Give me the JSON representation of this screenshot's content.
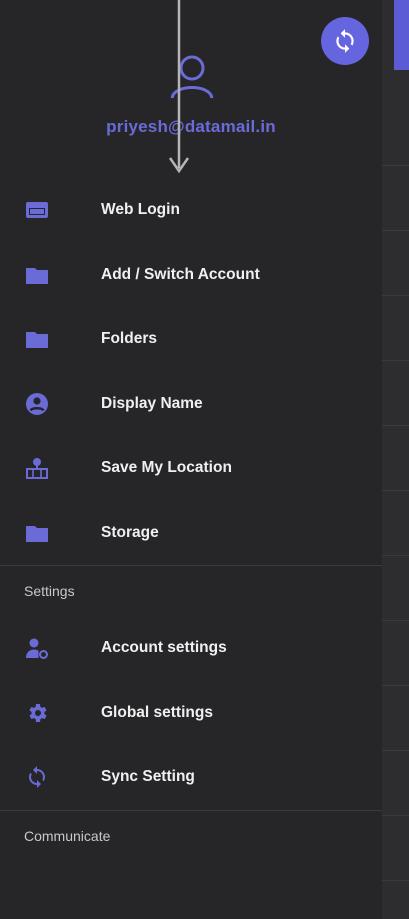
{
  "profile": {
    "email": "priyesh@datamail.in"
  },
  "menu": {
    "items": [
      {
        "label": "Web Login",
        "icon": "web-login-icon"
      },
      {
        "label": "Add / Switch Account",
        "icon": "folder-icon"
      },
      {
        "label": "Folders",
        "icon": "folder-icon"
      },
      {
        "label": "Display Name",
        "icon": "account-circle-icon"
      },
      {
        "label": "Save My Location",
        "icon": "map-location-icon"
      },
      {
        "label": "Storage",
        "icon": "folder-icon"
      }
    ]
  },
  "settings": {
    "title": "Settings",
    "items": [
      {
        "label": "Account settings",
        "icon": "account-settings-icon"
      },
      {
        "label": "Global settings",
        "icon": "gear-icon"
      },
      {
        "label": "Sync Setting",
        "icon": "sync-icon"
      }
    ]
  },
  "communicate": {
    "title": "Communicate"
  },
  "colors": {
    "accent": "#6665e0",
    "icon": "#6b6bd8",
    "background": "#262628",
    "text": "#f0f0f0"
  }
}
